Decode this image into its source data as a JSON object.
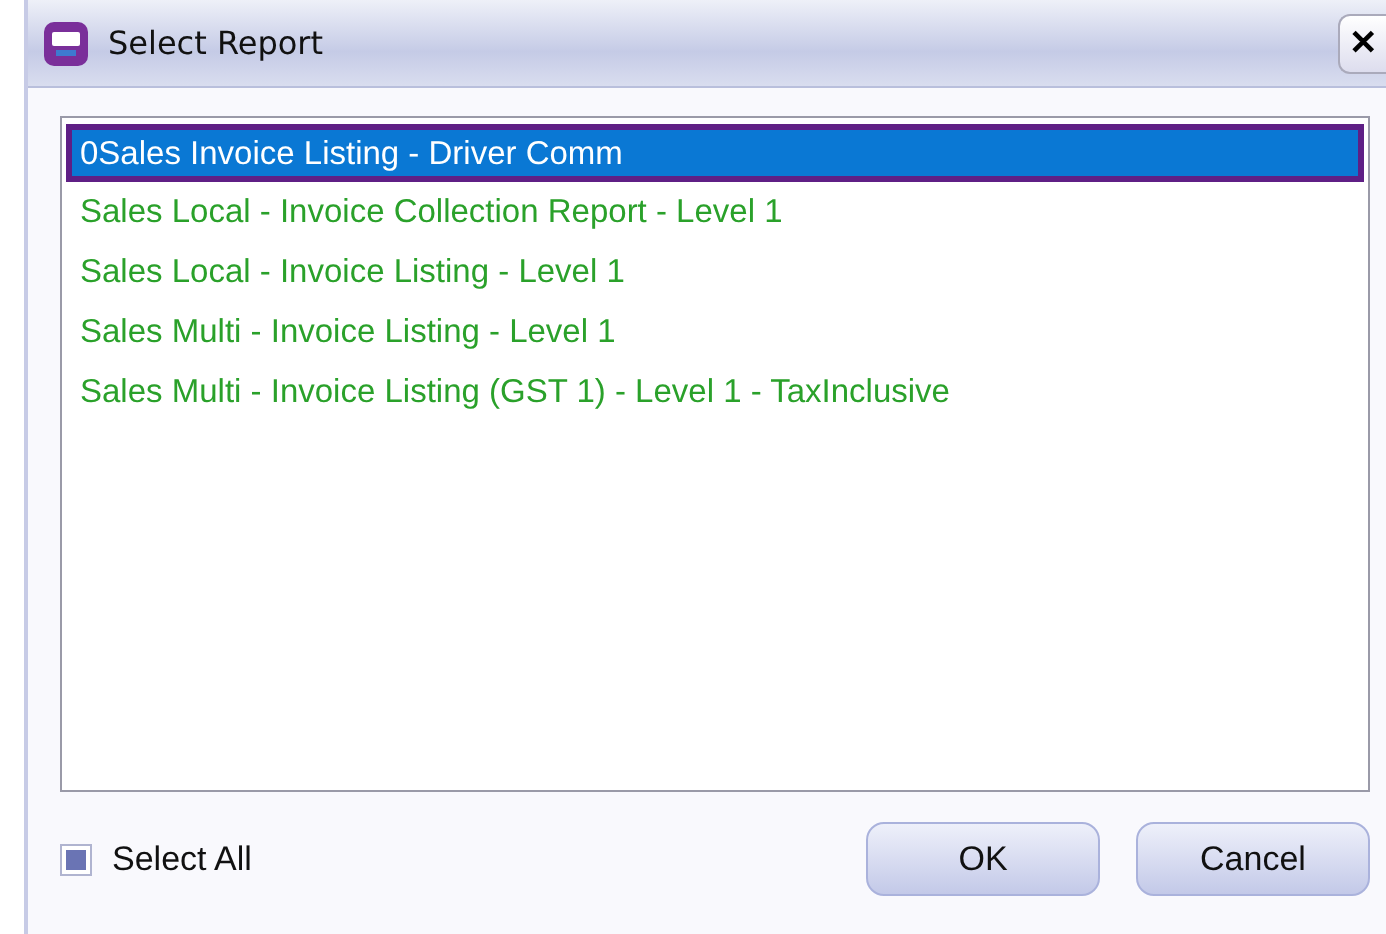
{
  "window": {
    "title": "Select Report",
    "close": "✕"
  },
  "reports": [
    {
      "label": "0Sales Invoice Listing - Driver Comm",
      "selected": true
    },
    {
      "label": "Sales Local - Invoice Collection Report - Level 1",
      "selected": false
    },
    {
      "label": "Sales Local - Invoice Listing - Level 1",
      "selected": false
    },
    {
      "label": "Sales Multi - Invoice Listing - Level 1",
      "selected": false
    },
    {
      "label": "Sales Multi - Invoice Listing (GST 1) - Level 1 - TaxInclusive",
      "selected": false
    }
  ],
  "select_all": {
    "label": "Select All",
    "checked": true
  },
  "buttons": [
    "OK",
    "Cancel"
  ]
}
